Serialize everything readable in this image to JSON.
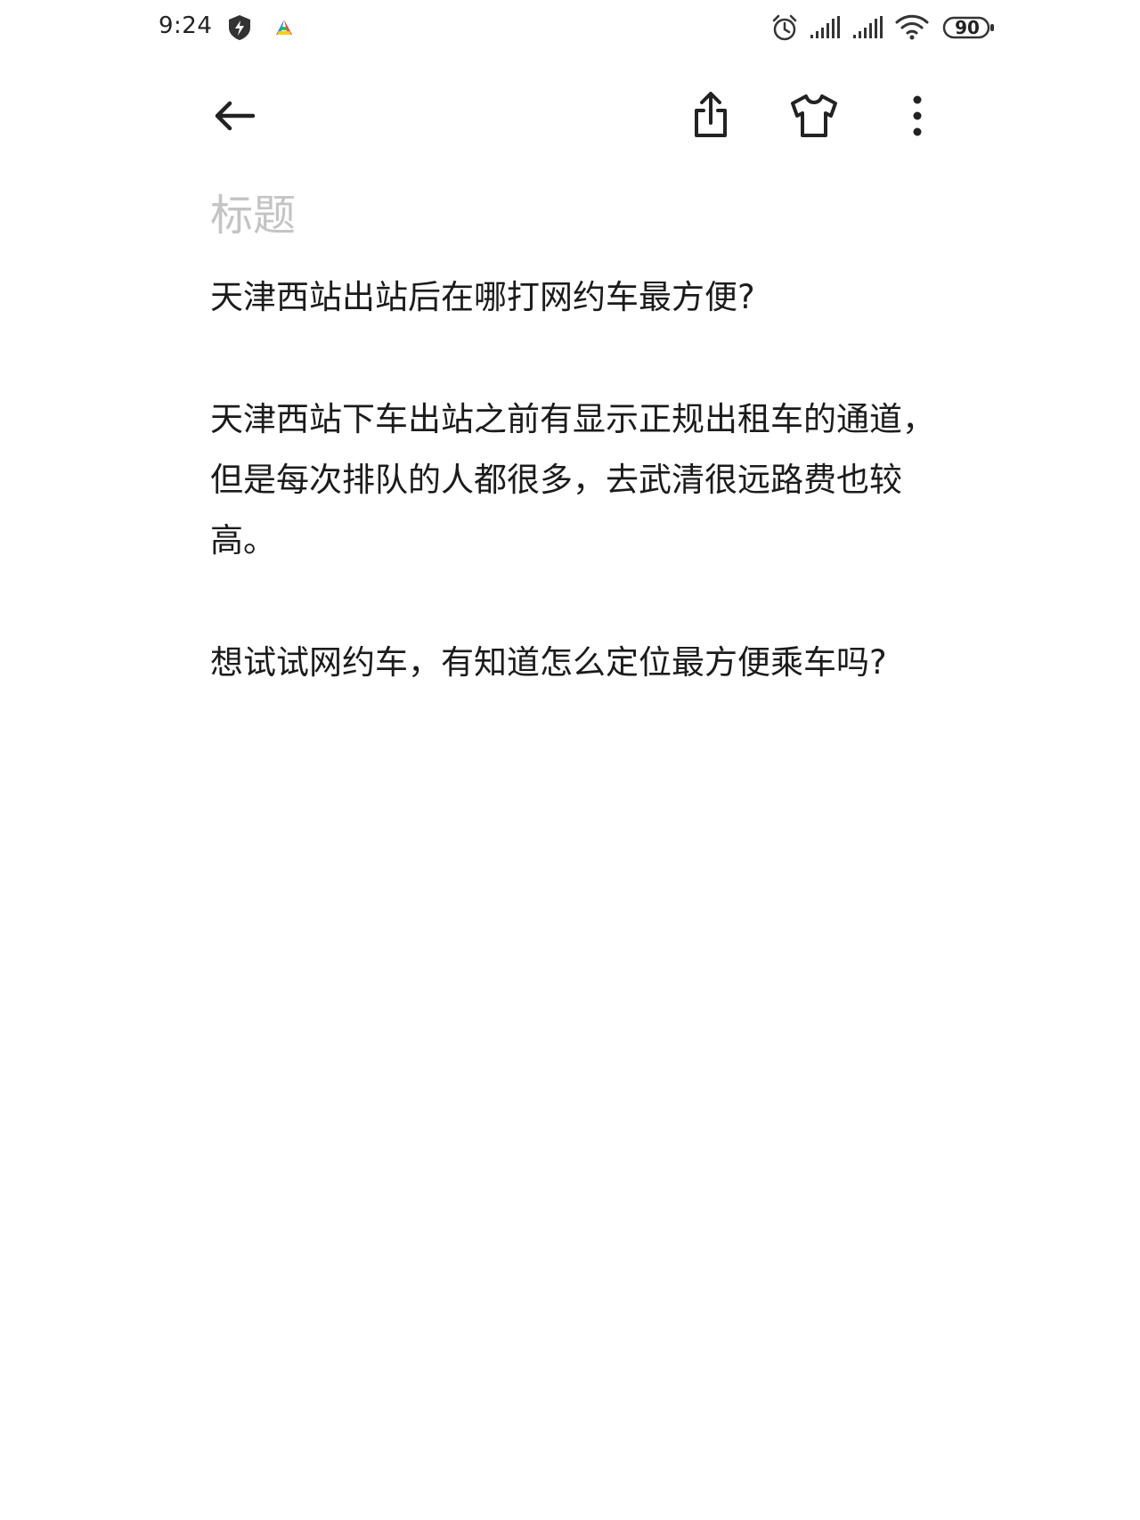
{
  "status_bar": {
    "time": "9:24",
    "battery": "90",
    "icons": [
      "shield-icon",
      "app-icon",
      "alarm-icon",
      "signal-icon",
      "signal-icon",
      "wifi-icon",
      "battery-icon"
    ]
  },
  "toolbar": {
    "icons": [
      "back-arrow-icon",
      "share-icon",
      "tshirt-icon",
      "more-vertical-icon"
    ]
  },
  "note": {
    "title_placeholder": "标题",
    "paragraphs": [
      "天津西站出站后在哪打网约车最方便?",
      "天津西站下车出站之前有显示正规出租车的通道，但是每次排队的人都很多，去武清很远路费也较高。",
      "想试试网约车，有知道怎么定位最方便乘车吗?"
    ]
  },
  "colors": {
    "background": "#ffffff",
    "text": "#1b1b1b",
    "placeholder": "#c4c4c4",
    "icon": "#222222"
  }
}
